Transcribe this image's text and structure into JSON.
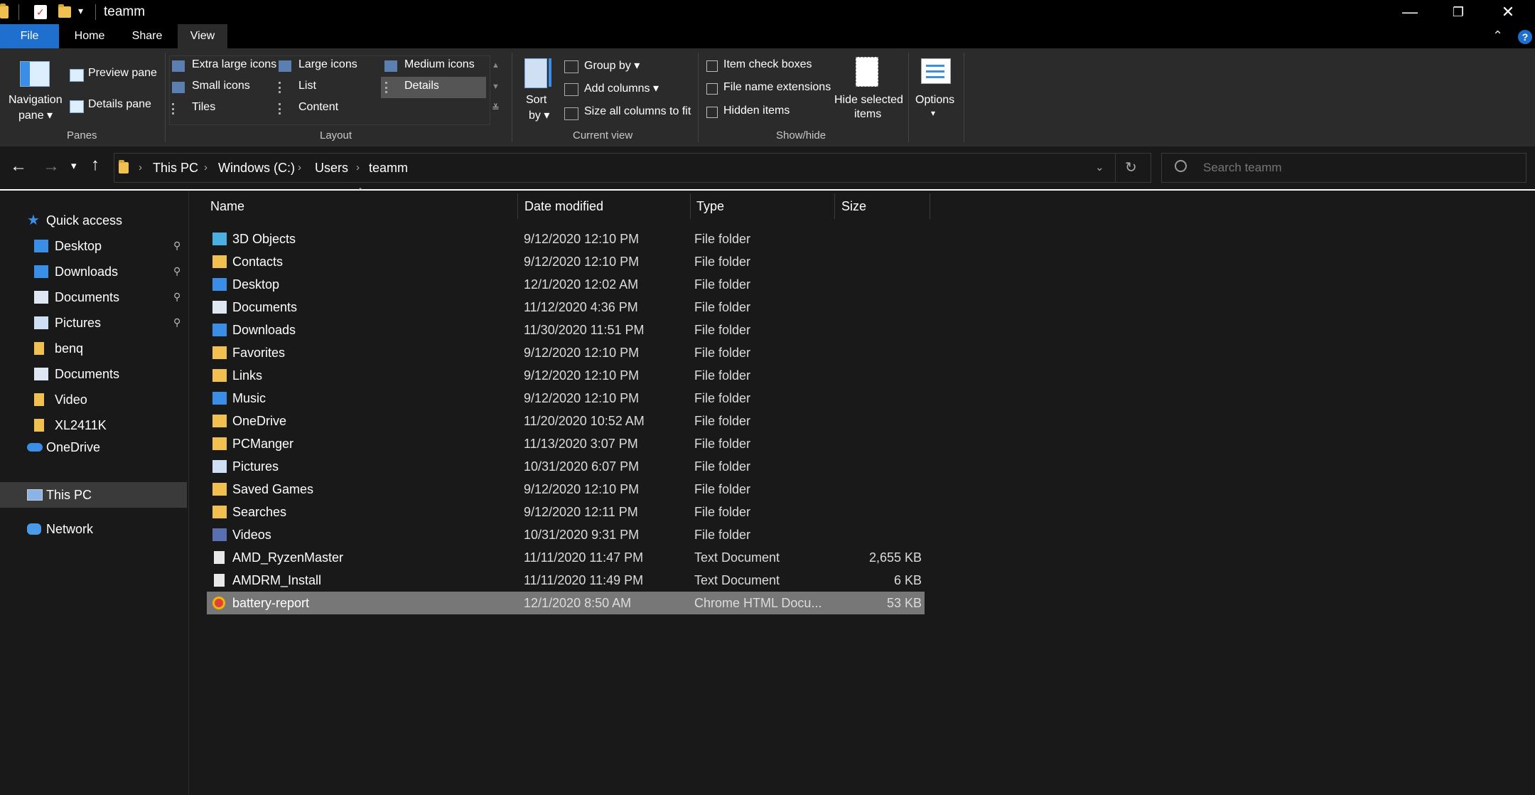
{
  "window": {
    "title": "teamm",
    "minimize": "—",
    "restore": "❐",
    "close": "✕",
    "quick_access_dropdown": "▾"
  },
  "ribbon_tabs": [
    "File",
    "Home",
    "Share",
    "View"
  ],
  "ribbon": {
    "panes": {
      "navigation_pane_line1": "Navigation",
      "navigation_pane_line2": "pane ▾",
      "preview_pane": "Preview pane",
      "details_pane": "Details pane",
      "group_label": "Panes"
    },
    "layout": {
      "extra_large_icons": "Extra large icons",
      "large_icons": "Large icons",
      "medium_icons": "Medium icons",
      "small_icons": "Small icons",
      "list": "List",
      "details": "Details",
      "tiles": "Tiles",
      "content": "Content",
      "group_label": "Layout"
    },
    "current_view": {
      "sort_by_line1": "Sort",
      "sort_by_line2": "by ▾",
      "group_by": "Group by ▾",
      "add_columns": "Add columns ▾",
      "size_all_columns": "Size all columns to fit",
      "group_label": "Current view"
    },
    "show_hide": {
      "item_check_boxes": "Item check boxes",
      "file_name_extensions": "File name extensions",
      "hidden_items": "Hidden items",
      "hide_selected_line1": "Hide selected",
      "hide_selected_line2": "items",
      "group_label": "Show/hide"
    },
    "options": {
      "label": "Options",
      "arrow": "▾"
    }
  },
  "address": {
    "breadcrumbs": [
      "This PC",
      "Windows (C:)",
      "Users",
      "teamm"
    ],
    "search_placeholder": "Search teamm"
  },
  "nav": {
    "quick_access": "Quick access",
    "items": [
      {
        "label": "Desktop",
        "pinned": true
      },
      {
        "label": "Downloads",
        "pinned": true
      },
      {
        "label": "Documents",
        "pinned": true
      },
      {
        "label": "Pictures",
        "pinned": true
      },
      {
        "label": "benq",
        "pinned": false
      },
      {
        "label": "Documents",
        "pinned": false
      },
      {
        "label": "Video",
        "pinned": false
      },
      {
        "label": "XL2411K",
        "pinned": false
      }
    ],
    "onedrive": "OneDrive",
    "this_pc": "This PC",
    "network": "Network"
  },
  "columns": {
    "name": "Name",
    "date": "Date modified",
    "type": "Type",
    "size": "Size"
  },
  "files": [
    {
      "name": "3D Objects",
      "date": "9/12/2020 12:10 PM",
      "type": "File folder",
      "size": "",
      "icon": "3d-objects-icon"
    },
    {
      "name": "Contacts",
      "date": "9/12/2020 12:10 PM",
      "type": "File folder",
      "size": "",
      "icon": "contacts-folder-icon"
    },
    {
      "name": "Desktop",
      "date": "12/1/2020 12:02 AM",
      "type": "File folder",
      "size": "",
      "icon": "desktop-folder-icon"
    },
    {
      "name": "Documents",
      "date": "11/12/2020 4:36 PM",
      "type": "File folder",
      "size": "",
      "icon": "documents-folder-icon"
    },
    {
      "name": "Downloads",
      "date": "11/30/2020 11:51 PM",
      "type": "File folder",
      "size": "",
      "icon": "downloads-folder-icon"
    },
    {
      "name": "Favorites",
      "date": "9/12/2020 12:10 PM",
      "type": "File folder",
      "size": "",
      "icon": "favorites-folder-icon"
    },
    {
      "name": "Links",
      "date": "9/12/2020 12:10 PM",
      "type": "File folder",
      "size": "",
      "icon": "links-folder-icon"
    },
    {
      "name": "Music",
      "date": "9/12/2020 12:10 PM",
      "type": "File folder",
      "size": "",
      "icon": "music-folder-icon"
    },
    {
      "name": "OneDrive",
      "date": "11/20/2020 10:52 AM",
      "type": "File folder",
      "size": "",
      "icon": "onedrive-folder-icon"
    },
    {
      "name": "PCManger",
      "date": "11/13/2020 3:07 PM",
      "type": "File folder",
      "size": "",
      "icon": "folder-icon"
    },
    {
      "name": "Pictures",
      "date": "10/31/2020 6:07 PM",
      "type": "File folder",
      "size": "",
      "icon": "pictures-folder-icon"
    },
    {
      "name": "Saved Games",
      "date": "9/12/2020 12:10 PM",
      "type": "File folder",
      "size": "",
      "icon": "saved-games-folder-icon"
    },
    {
      "name": "Searches",
      "date": "9/12/2020 12:11 PM",
      "type": "File folder",
      "size": "",
      "icon": "searches-folder-icon"
    },
    {
      "name": "Videos",
      "date": "10/31/2020 9:31 PM",
      "type": "File folder",
      "size": "",
      "icon": "videos-folder-icon"
    },
    {
      "name": "AMD_RyzenMaster",
      "date": "11/11/2020 11:47 PM",
      "type": "Text Document",
      "size": "2,655 KB",
      "icon": "text-document-icon"
    },
    {
      "name": "AMDRM_Install",
      "date": "11/11/2020 11:49 PM",
      "type": "Text Document",
      "size": "6 KB",
      "icon": "text-document-icon"
    },
    {
      "name": "battery-report",
      "date": "12/1/2020 8:50 AM",
      "type": "Chrome HTML Docu...",
      "size": "53 KB",
      "icon": "chrome-html-icon",
      "selected": true
    }
  ],
  "colors": {
    "accent": "#1f6fce",
    "background": "#191919",
    "ribbon": "#2b2b2b",
    "selection": "#777777",
    "folder": "#f0c050"
  }
}
